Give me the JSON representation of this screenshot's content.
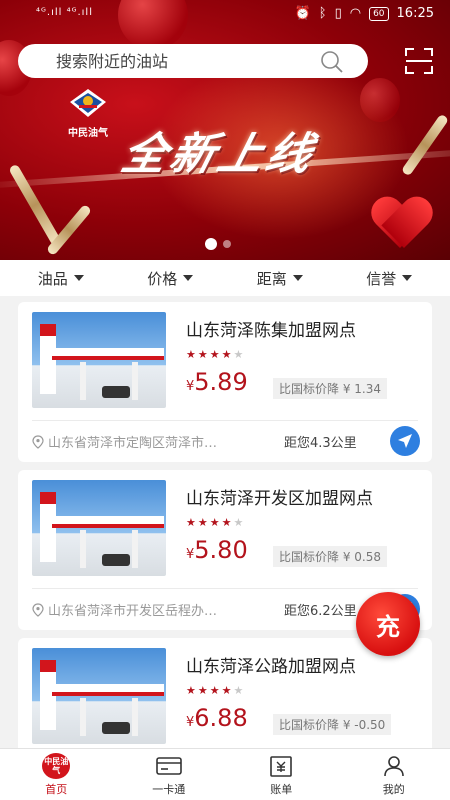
{
  "status_bar": {
    "signal_text": "⁴ᴳ.ıll ⁴ᴳ.ıll",
    "battery": "60",
    "time": "16:25"
  },
  "search": {
    "placeholder": "搜索附近的油站"
  },
  "banner": {
    "brand_text": "中民油气",
    "headline": "全新上线"
  },
  "filters": [
    {
      "label": "油品"
    },
    {
      "label": "价格"
    },
    {
      "label": "距离"
    },
    {
      "label": "信誉"
    }
  ],
  "stations": [
    {
      "name": "山东菏泽陈集加盟网点",
      "rating": 4,
      "currency": "¥",
      "price": "5.89",
      "diff": "比国标价降 ¥ 1.34",
      "address": "山东省菏泽市定陶区菏泽市…",
      "distance": "距您4.3公里"
    },
    {
      "name": "山东菏泽开发区加盟网点",
      "rating": 4,
      "currency": "¥",
      "price": "5.80",
      "diff": "比国标价降 ¥ 0.58",
      "address": "山东省菏泽市开发区岳程办…",
      "distance": "距您6.2公里"
    },
    {
      "name": "山东菏泽公路加盟网点",
      "rating": 4,
      "currency": "¥",
      "price": "6.88",
      "diff": "比国标价降 ¥ -0.50",
      "address": "",
      "distance": ""
    }
  ],
  "charge_button": "充",
  "tabs": [
    {
      "label": "首页",
      "badge": "中民油气",
      "active": true
    },
    {
      "label": "一卡通"
    },
    {
      "label": "账单"
    },
    {
      "label": "我的"
    }
  ],
  "colors": {
    "brand_red": "#b3131c",
    "nav_blue": "#2e7fe0"
  }
}
